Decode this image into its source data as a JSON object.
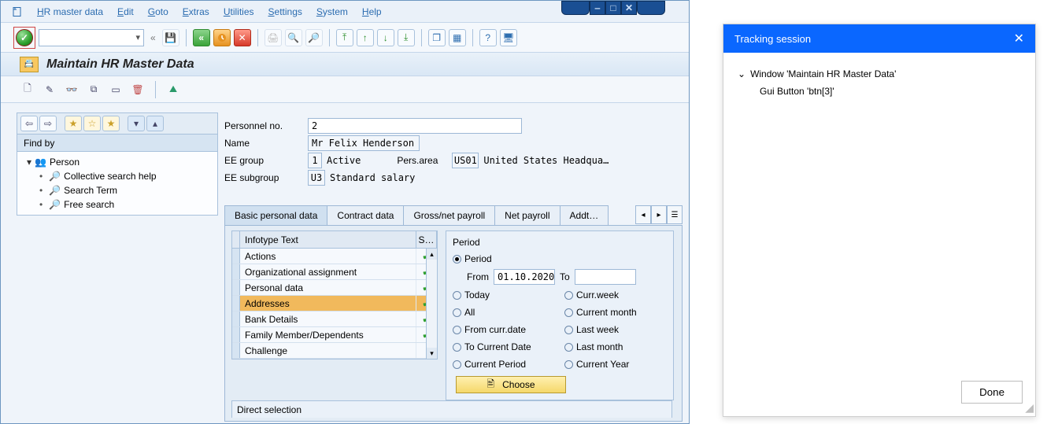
{
  "menu": {
    "items": [
      "HR master data",
      "Edit",
      "Goto",
      "Extras",
      "Utilities",
      "Settings",
      "System",
      "Help"
    ]
  },
  "tooltip_back": "Back   (F3)",
  "page_title": "Maintain HR Master Data",
  "findby": {
    "header": "Find by",
    "person": "Person",
    "items": [
      "Collective search help",
      "Search Term",
      "Free search"
    ]
  },
  "form": {
    "pernr_label": "Personnel no.",
    "pernr_value": "2",
    "name_label": "Name",
    "name_value": "Mr Felix Henderson",
    "eegrp_label": "EE group",
    "eegrp_code": "1",
    "eegrp_text": "Active",
    "persarea_label": "Pers.area",
    "persarea_code": "US01",
    "persarea_text": "United States Headqua…",
    "eesub_label": "EE subgroup",
    "eesub_code": "U3",
    "eesub_text": "Standard salary"
  },
  "tabs": {
    "items": [
      "Basic personal data",
      "Contract data",
      "Gross/net payroll",
      "Net payroll",
      "Addt…"
    ],
    "active": 0
  },
  "infotype": {
    "col1": "Infotype Text",
    "col2": "S…",
    "rows": [
      {
        "t": "Actions",
        "s": true
      },
      {
        "t": "Organizational assignment",
        "s": true
      },
      {
        "t": "Personal data",
        "s": true
      },
      {
        "t": "Addresses",
        "s": true,
        "sel": true
      },
      {
        "t": "Bank Details",
        "s": true
      },
      {
        "t": "Family Member/Dependents",
        "s": true
      },
      {
        "t": "Challenge",
        "s": false
      }
    ]
  },
  "period": {
    "group_title": "Period",
    "period_label": "Period",
    "from_label": "From",
    "from_value": "01.10.2020",
    "to_label": "To",
    "to_value": "",
    "today": "Today",
    "currweek": "Curr.week",
    "all": "All",
    "currmonth": "Current month",
    "fromcurr": "From curr.date",
    "lastweek": "Last week",
    "tocurr": "To Current Date",
    "lastmonth": "Last month",
    "currperiod": "Current Period",
    "curryear": "Current Year",
    "choose": "Choose"
  },
  "direct_sel": "Direct selection",
  "track": {
    "title": "Tracking session",
    "win": "Window 'Maintain HR Master Data'",
    "btn": "Gui Button 'btn[3]'",
    "done": "Done"
  }
}
